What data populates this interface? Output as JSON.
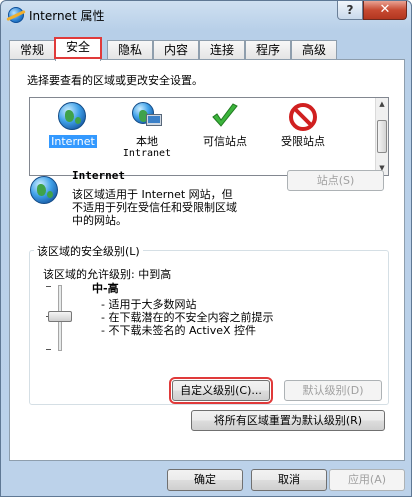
{
  "window": {
    "title": "Internet 属性"
  },
  "titlebar": {
    "help": "?",
    "close": "✕"
  },
  "tabs": [
    {
      "label": "常规",
      "active": false
    },
    {
      "label": "安全",
      "active": true
    },
    {
      "label": "隐私",
      "active": false
    },
    {
      "label": "内容",
      "active": false
    },
    {
      "label": "连接",
      "active": false
    },
    {
      "label": "程序",
      "active": false
    },
    {
      "label": "高级",
      "active": false
    }
  ],
  "security": {
    "select_zone_prompt": "选择要查看的区域或更改安全设置。",
    "zones": [
      {
        "label": "Internet",
        "icon": "globe-icon",
        "selected": true
      },
      {
        "label": "本地",
        "sub": "Intranet",
        "icon": "intranet-icon",
        "selected": false
      },
      {
        "label": "可信站点",
        "icon": "checkmark-icon",
        "selected": false
      },
      {
        "label": "受限站点",
        "icon": "restricted-icon",
        "selected": false
      }
    ],
    "zone_info": {
      "name": "Internet",
      "desc1": "该区域适用于 Internet 网站，但",
      "desc2": "不适用于列在受信任和受限制区域",
      "desc3": "中的网站。"
    },
    "sites_button": "站点(S)",
    "level_group_title": "该区域的安全级别(L)",
    "allowed_levels": "该区域的允许级别: 中到高",
    "level_name": "中-高",
    "level_bullets": [
      "- 适用于大多数网站",
      "- 在下载潜在的不安全内容之前提示",
      "- 不下载未签名的 ActiveX 控件"
    ],
    "custom_level_button": "自定义级别(C)...",
    "default_level_button": "默认级别(D)",
    "reset_all_button": "将所有区域重置为默认级别(R)"
  },
  "footer": {
    "ok": "确定",
    "cancel": "取消",
    "apply": "应用(A)"
  },
  "colors": {
    "highlight_box": "#e03a3a",
    "selection": "#3399ff"
  }
}
